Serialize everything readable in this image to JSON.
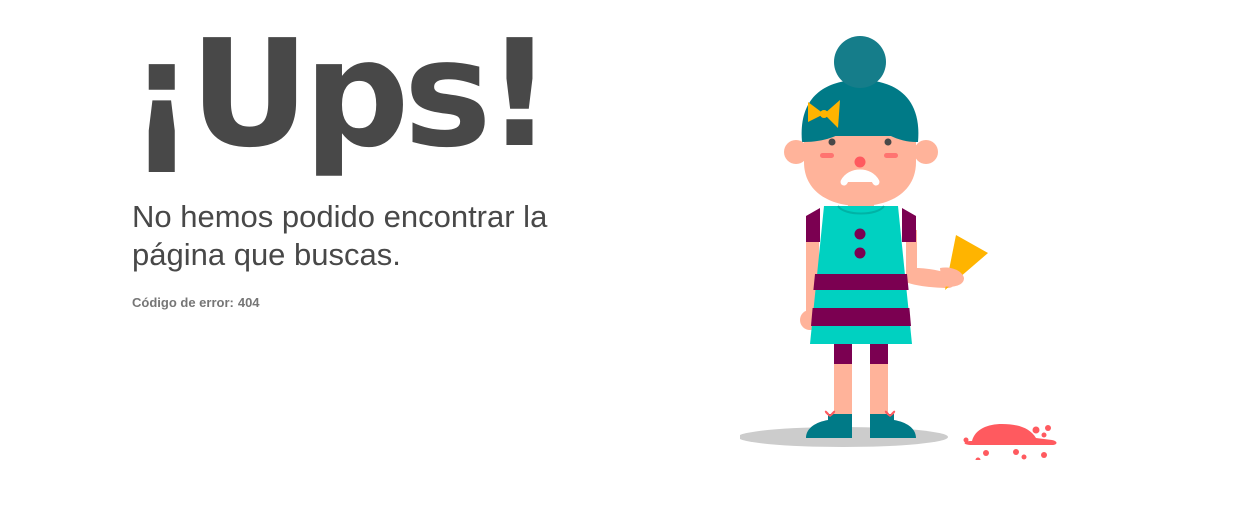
{
  "page": {
    "headline": "¡Ups!",
    "message": "No hemos podido encontrar la página que buscas.",
    "error_label": "Código de error:",
    "error_code": "404"
  },
  "illustration": {
    "subject": "sad girl dropped ice cream",
    "colors": {
      "hair": "#007A87",
      "bun": "#157D8A",
      "skin": "#FFB39A",
      "dress": "#00D1C1",
      "stripes": "#7B0051",
      "bow": "#FFB400",
      "cone": "#FFB400",
      "ice_cream": "#FF5A5F",
      "shadow": "#CCCCCC",
      "cheeks": "#FF5A5F"
    }
  }
}
